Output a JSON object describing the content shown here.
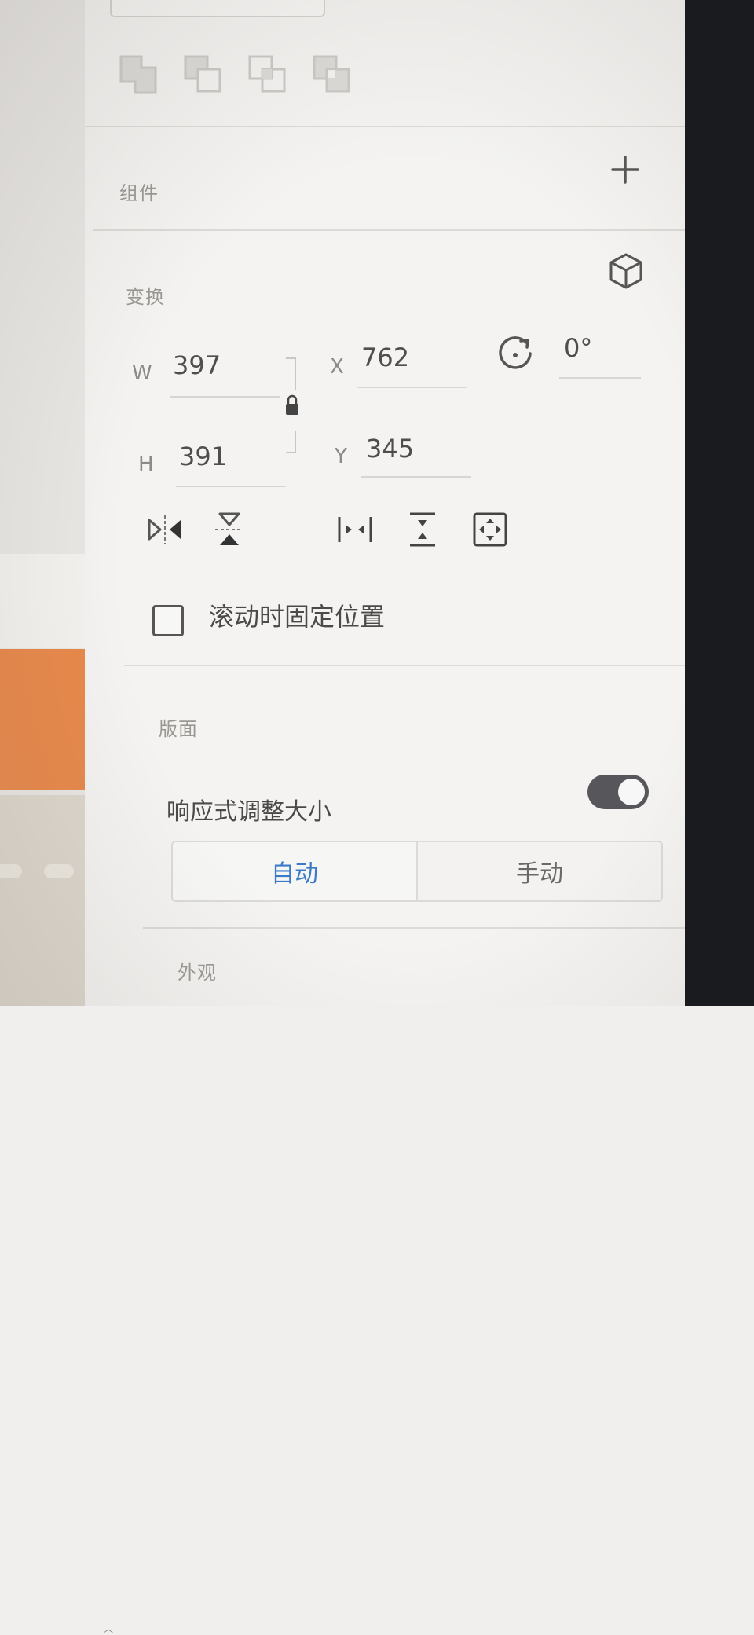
{
  "panel": {
    "sections": {
      "component": "组件",
      "transform": "变换",
      "layout": "版面",
      "appearance": "外观"
    },
    "transform": {
      "w_label": "W",
      "w_value": "397",
      "h_label": "H",
      "h_value": "391",
      "x_label": "X",
      "x_value": "762",
      "y_label": "Y",
      "y_value": "345",
      "rotation_value": "0°"
    },
    "fix_on_scroll": {
      "label": "滚动时固定位置",
      "checked": false
    },
    "responsive": {
      "label": "响应式调整大小",
      "enabled": true,
      "options": [
        "自动",
        "手动"
      ],
      "selected": "自动"
    }
  },
  "icons": {
    "add": "plus-icon",
    "component3d": "cube-icon",
    "lock": "lock-icon",
    "rotate": "rotate-icon"
  },
  "colors": {
    "accent": "#3b7ac9",
    "toggle_on": "#57565a",
    "canvas_orange": "#e8884a"
  }
}
